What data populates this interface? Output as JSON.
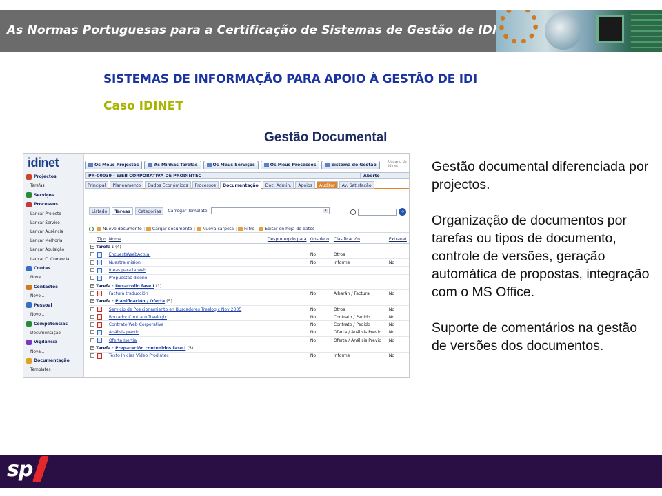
{
  "slide": {
    "header_title": "As Normas Portuguesas para a Certificação de Sistemas de Gestão de IDI",
    "title": "SISTEMAS DE INFORMAÇÃO PARA APOIO À GESTÃO DE IDI",
    "subtitle": "Caso IDINET",
    "section_heading": "Gestão Documental",
    "body_paragraphs": [
      "Gestão documental diferenciada por projectos.",
      "Organização de documentos por tarefas ou tipos de documento, controle de versões, geração automática de propostas, integração com o MS Office.",
      "Suporte de comentários na gestão de versões dos documentos."
    ],
    "footer_logo": "sp"
  },
  "colors": {
    "header_bar": "#6b6b6b",
    "title_blue": "#1a33a0",
    "subtitle_olive": "#a8b400",
    "footer_bar": "#2a0f45",
    "accent_orange": "#e0862a"
  },
  "app": {
    "logo_main": "idinet",
    "sidebar": [
      {
        "label": "Projectos",
        "type": "section",
        "icon": "projects-icon",
        "color": "#d0452a"
      },
      {
        "label": "Tarefas",
        "type": "sub"
      },
      {
        "label": "Serviços",
        "type": "section",
        "icon": "services-icon",
        "color": "#2a8a3a"
      },
      {
        "label": "Processos",
        "type": "section",
        "icon": "processes-icon",
        "color": "#c23a3a"
      },
      {
        "label": "Lançar Projecto",
        "type": "sub"
      },
      {
        "label": "Lançar Serviço",
        "type": "sub"
      },
      {
        "label": "Lançar Ausência",
        "type": "sub"
      },
      {
        "label": "Lançar Melhoria",
        "type": "sub"
      },
      {
        "label": "Lançar Aquisição",
        "type": "sub"
      },
      {
        "label": "Lançar C. Comercial",
        "type": "sub"
      },
      {
        "label": "Contas",
        "type": "section",
        "icon": "accounts-icon",
        "color": "#3a6fc0"
      },
      {
        "label": "Nova...",
        "type": "sub"
      },
      {
        "label": "Contactos",
        "type": "section",
        "icon": "contacts-icon",
        "color": "#d07a20"
      },
      {
        "label": "Novo...",
        "type": "sub"
      },
      {
        "label": "Pessoal",
        "type": "section",
        "icon": "staff-icon",
        "color": "#3a6fc0"
      },
      {
        "label": "Novo...",
        "type": "sub"
      },
      {
        "label": "Competências",
        "type": "section",
        "icon": "skills-icon",
        "color": "#2a8a3a"
      },
      {
        "label": "Documentação",
        "type": "sub"
      },
      {
        "label": "Vigilância",
        "type": "section",
        "icon": "watch-icon",
        "color": "#7a3ac0"
      },
      {
        "label": "Nova...",
        "type": "sub"
      },
      {
        "label": "Documentação",
        "type": "section",
        "icon": "documentation-icon",
        "color": "#e0a020"
      },
      {
        "label": "Templates",
        "type": "sub"
      }
    ],
    "top_tabs": [
      {
        "label": "Os Meus Projectos",
        "icon": "my-projects-icon"
      },
      {
        "label": "As Minhas Tarefas",
        "icon": "my-tasks-icon"
      },
      {
        "label": "Os Meus Serviços",
        "icon": "my-services-icon"
      },
      {
        "label": "Os Meus Processos",
        "icon": "my-processes-icon"
      },
      {
        "label": "Sistema de Gestão",
        "icon": "management-system-icon"
      }
    ],
    "user_label": "Usuario de idinet",
    "project_code": "PR-00039 - WEB CORPORATIVA DE PRODINTEC",
    "project_status": "Aberto",
    "nav_tabs": [
      "Principal",
      "Planeamento",
      "Dados Económicos",
      "Processos",
      "Documentação",
      "Doc. Admin.",
      "Apoios",
      "Auditor",
      "Av. Satisfação"
    ],
    "nav_active": "Documentação",
    "sub_tabs": [
      "Listado",
      "Tareas",
      "Categorias"
    ],
    "sub_active": "Tareas",
    "template_label": "Carregar Template:",
    "toolbar": [
      "Nuevo documento",
      "Cargar documento",
      "Nueva carpeta",
      "Filtro",
      "Editar en hoja de datos"
    ],
    "table_headers": [
      "Tipo",
      "Nome",
      "Desprotegido para",
      "Obsoleto",
      "Clasificación",
      "Extranet"
    ],
    "groups": [
      {
        "label": "Tarefa :",
        "task": "",
        "count": "(4)",
        "rows": [
          {
            "icon": "word",
            "name": "EncuestaWebActual",
            "obsoleto": "No",
            "clasif": "Otros",
            "extranet": ""
          },
          {
            "icon": "word",
            "name": "Nuestra misión",
            "obsoleto": "No",
            "clasif": "Informe",
            "extranet": "No"
          },
          {
            "icon": "word",
            "name": "Ideas para la web",
            "obsoleto": "",
            "clasif": "",
            "extranet": ""
          },
          {
            "icon": "word",
            "name": "Propuestas diseño",
            "obsoleto": "",
            "clasif": "",
            "extranet": ""
          }
        ]
      },
      {
        "label": "Tarefa :",
        "task": "Desarrollo fase I",
        "count": "(1)",
        "rows": [
          {
            "icon": "pdf",
            "name": "Factura traducción",
            "obsoleto": "No",
            "clasif": "Albarán / Factura",
            "extranet": "No"
          }
        ]
      },
      {
        "label": "Tarefa :",
        "task": "Planificación / Oferta",
        "count": "(5)",
        "rows": [
          {
            "icon": "pdf",
            "name": "Servicio de Posicionamiento en Buscadores Treelogic Nov 2005",
            "obsoleto": "No",
            "clasif": "Otros",
            "extranet": "No"
          },
          {
            "icon": "pdf",
            "name": "Borrador Contrato Treelogic",
            "obsoleto": "No",
            "clasif": "Contrato / Pedido",
            "extranet": "No"
          },
          {
            "icon": "pdf",
            "name": "Contrato Web Corporativa",
            "obsoleto": "No",
            "clasif": "Contrato / Pedido",
            "extranet": "No"
          },
          {
            "icon": "word",
            "name": "Análisis previo",
            "obsoleto": "No",
            "clasif": "Oferta / Análisis Previo",
            "extranet": "No"
          },
          {
            "icon": "word",
            "name": "Oferta Isertia",
            "obsoleto": "No",
            "clasif": "Oferta / Análisis Previo",
            "extranet": "No"
          }
        ]
      },
      {
        "label": "Tarefa :",
        "task": "Preparación contenidos fase I",
        "count": "(5)",
        "rows": [
          {
            "icon": "pdf",
            "name": "Texto Inicias Vídeo Prodintec",
            "obsoleto": "No",
            "clasif": "Informe",
            "extranet": "No"
          }
        ]
      }
    ]
  }
}
